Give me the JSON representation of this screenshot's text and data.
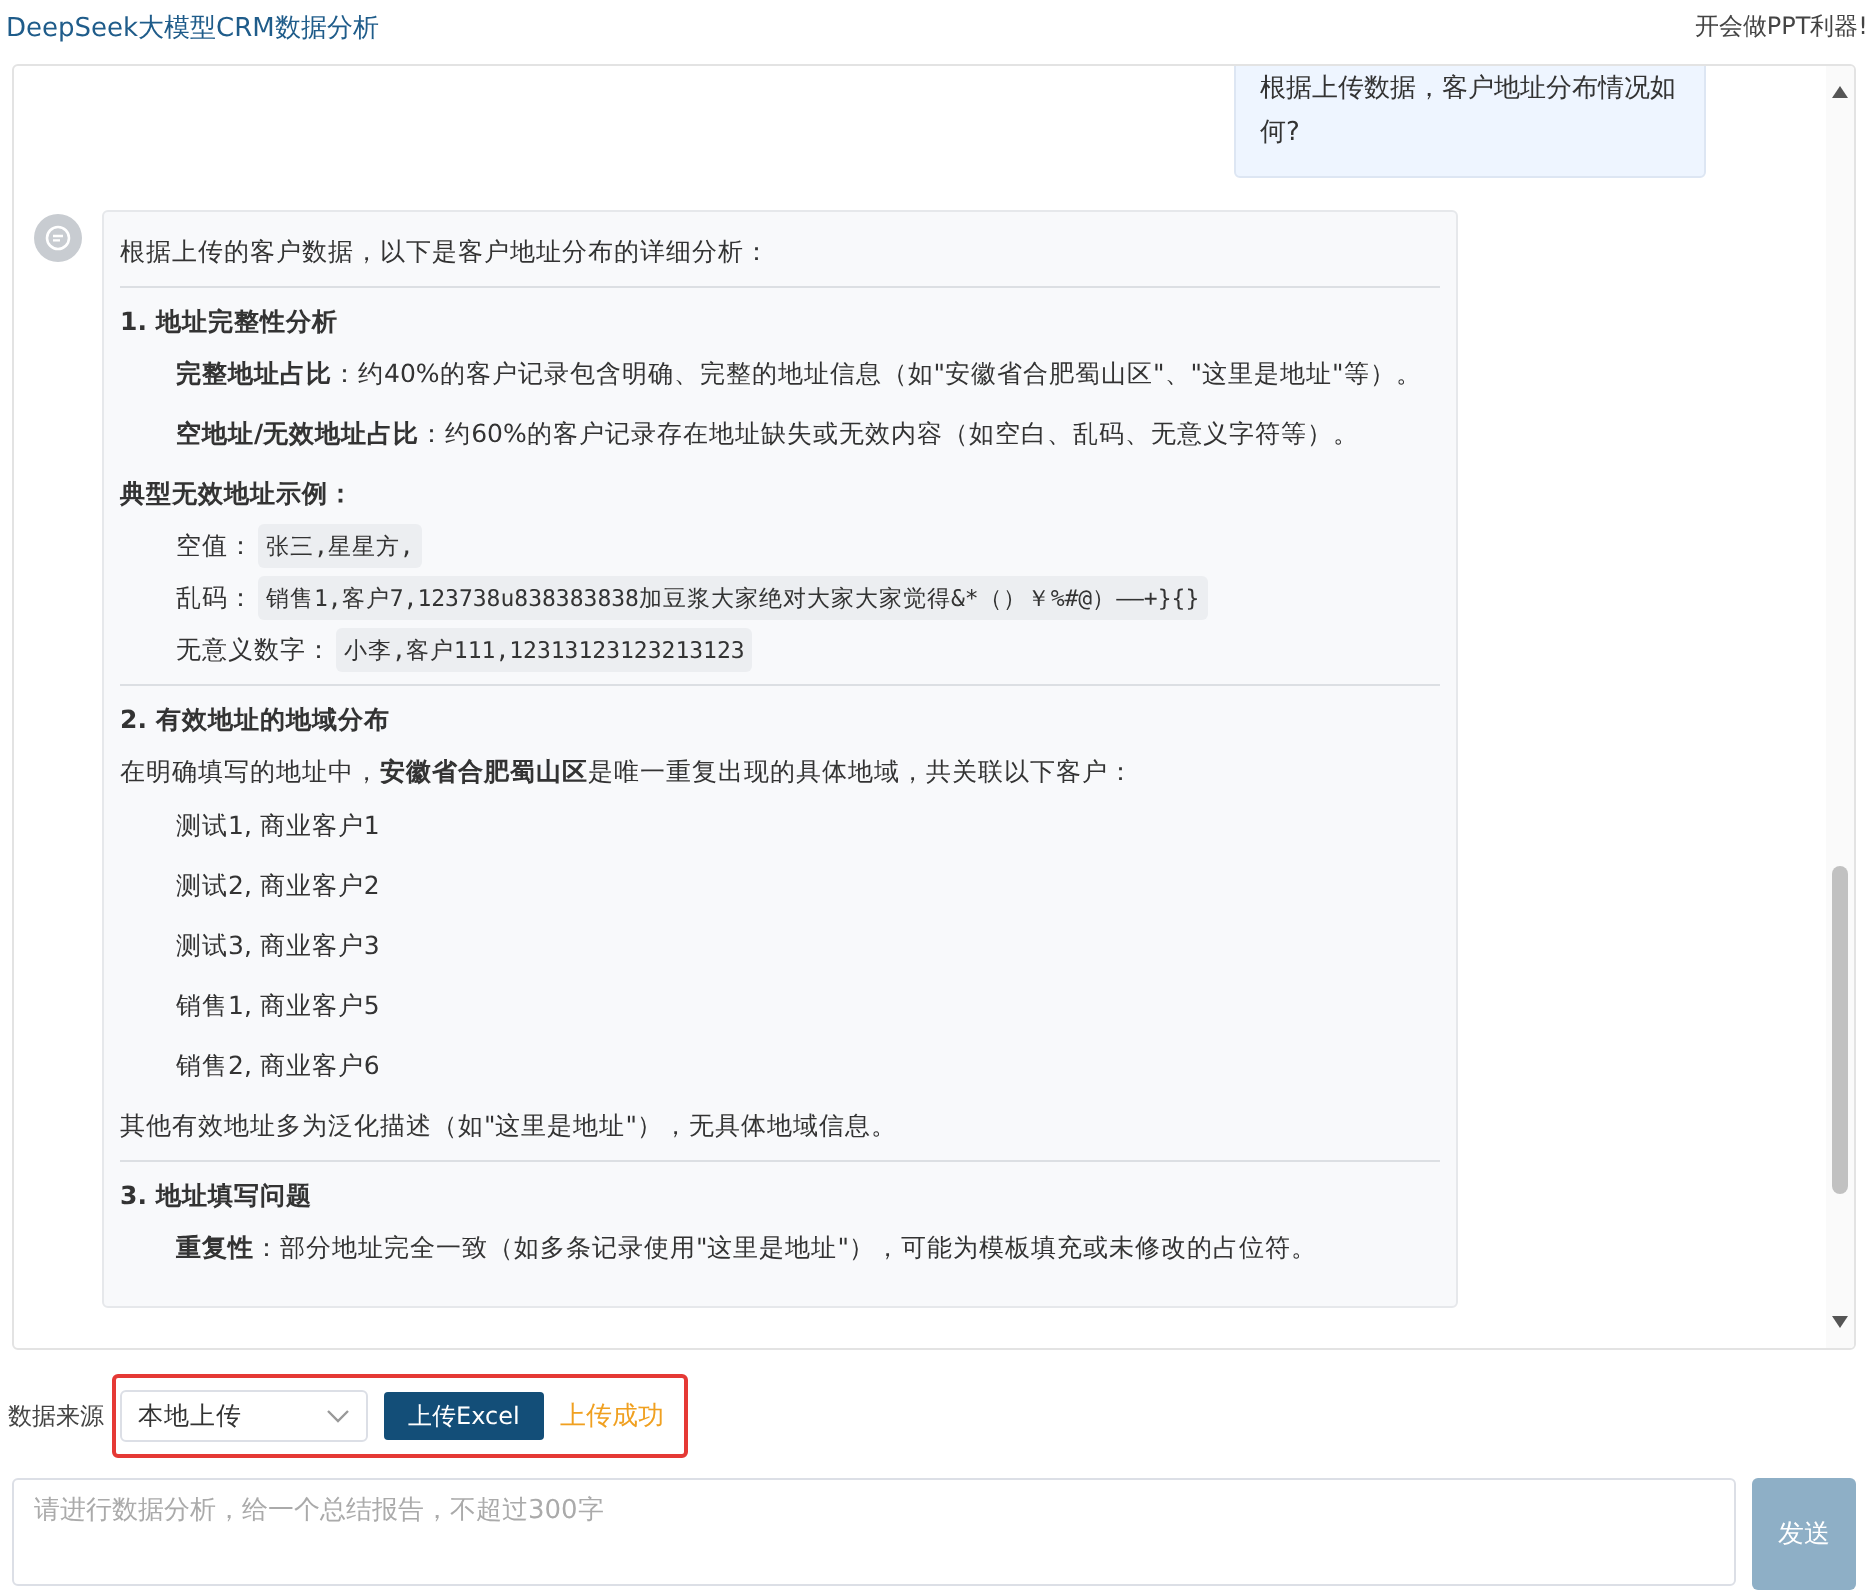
{
  "header": {
    "title": "DeepSeek大模型CRM数据分析",
    "slogan": "开会做PPT利器!"
  },
  "messages": [
    {
      "kind": "user",
      "text": "根据上传数据，客户地址分布情况如何?"
    },
    {
      "kind": "assistant",
      "blocks": [
        {
          "kind": "paragraph",
          "text": "根据上传的客户数据，以下是客户地址分布的详细分析："
        },
        {
          "kind": "divider"
        },
        {
          "kind": "heading",
          "text": "1. 地址完整性分析"
        },
        {
          "kind": "item",
          "text": "**完整地址占比**：约40%的客户记录包含明确、完整的地址信息（如\"安徽省合肥蜀山区\"、\"这里是地址\"等）。"
        },
        {
          "kind": "item",
          "text": "**空地址/无效地址占比**：约60%的客户记录存在地址缺失或无效内容（如空白、乱码、无意义字符等）。"
        },
        {
          "kind": "heading",
          "text": "典型无效地址示例："
        },
        {
          "kind": "code_item",
          "label": "空值：",
          "code": "张三,星星方,"
        },
        {
          "kind": "code_item",
          "label": "乱码：",
          "code": "销售1,客户7,123738u838383838加豆浆大家绝对大家大家觉得&*（）￥%#@）——+}{}"
        },
        {
          "kind": "code_item",
          "label": "无意义数字：",
          "code": "小李,客户111,12313123123213123"
        },
        {
          "kind": "divider"
        },
        {
          "kind": "heading",
          "text": "2. 有效地址的地域分布"
        },
        {
          "kind": "paragraph",
          "text": "在明确填写的地址中，**安徽省合肥蜀山区**是唯一重复出现的具体地域，共关联以下客户："
        },
        {
          "kind": "list_item",
          "text": "测试1, 商业客户1"
        },
        {
          "kind": "list_item",
          "text": "测试2, 商业客户2"
        },
        {
          "kind": "list_item",
          "text": "测试3, 商业客户3"
        },
        {
          "kind": "list_item",
          "text": "销售1, 商业客户5"
        },
        {
          "kind": "list_item",
          "text": "销售2, 商业客户6"
        },
        {
          "kind": "paragraph",
          "text": "其他有效地址多为泛化描述（如\"这里是地址\"），无具体地域信息。"
        },
        {
          "kind": "divider"
        },
        {
          "kind": "heading",
          "text": "3. 地址填写问题"
        },
        {
          "kind": "item",
          "text": "**重复性**：部分地址完全一致（如多条记录使用\"这里是地址\"），可能为模板填充或未修改的占位符。"
        }
      ]
    }
  ],
  "controls": {
    "source_label": "数据来源",
    "source_select": "本地上传",
    "upload_button": "上传Excel",
    "upload_status": "上传成功",
    "input_placeholder": "请进行数据分析，给一个总结报告，不超过300字",
    "send_button": "发送",
    "send_disabled": true
  }
}
